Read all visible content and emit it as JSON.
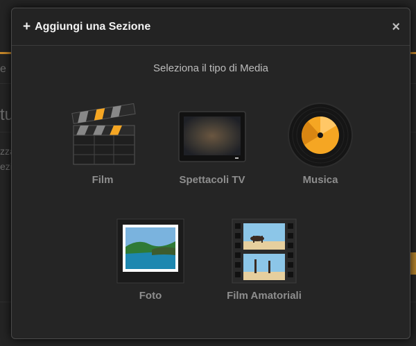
{
  "background": {
    "fragments": [
      "e",
      "tu",
      "zza",
      "ezi"
    ]
  },
  "modal": {
    "title": "Aggiungi una Sezione",
    "plus_icon": "+",
    "close_icon": "×",
    "subtitle": "Seleziona il tipo di Media",
    "media_types": [
      {
        "label": "Film",
        "icon": "clapperboard-icon"
      },
      {
        "label": "Spettacoli TV",
        "icon": "tv-icon"
      },
      {
        "label": "Musica",
        "icon": "vinyl-record-icon"
      },
      {
        "label": "Foto",
        "icon": "photo-icon"
      },
      {
        "label": "Film Amatoriali",
        "icon": "filmstrip-icon"
      }
    ]
  },
  "colors": {
    "accent": "#f5a623",
    "label": "#8e8e8e"
  }
}
